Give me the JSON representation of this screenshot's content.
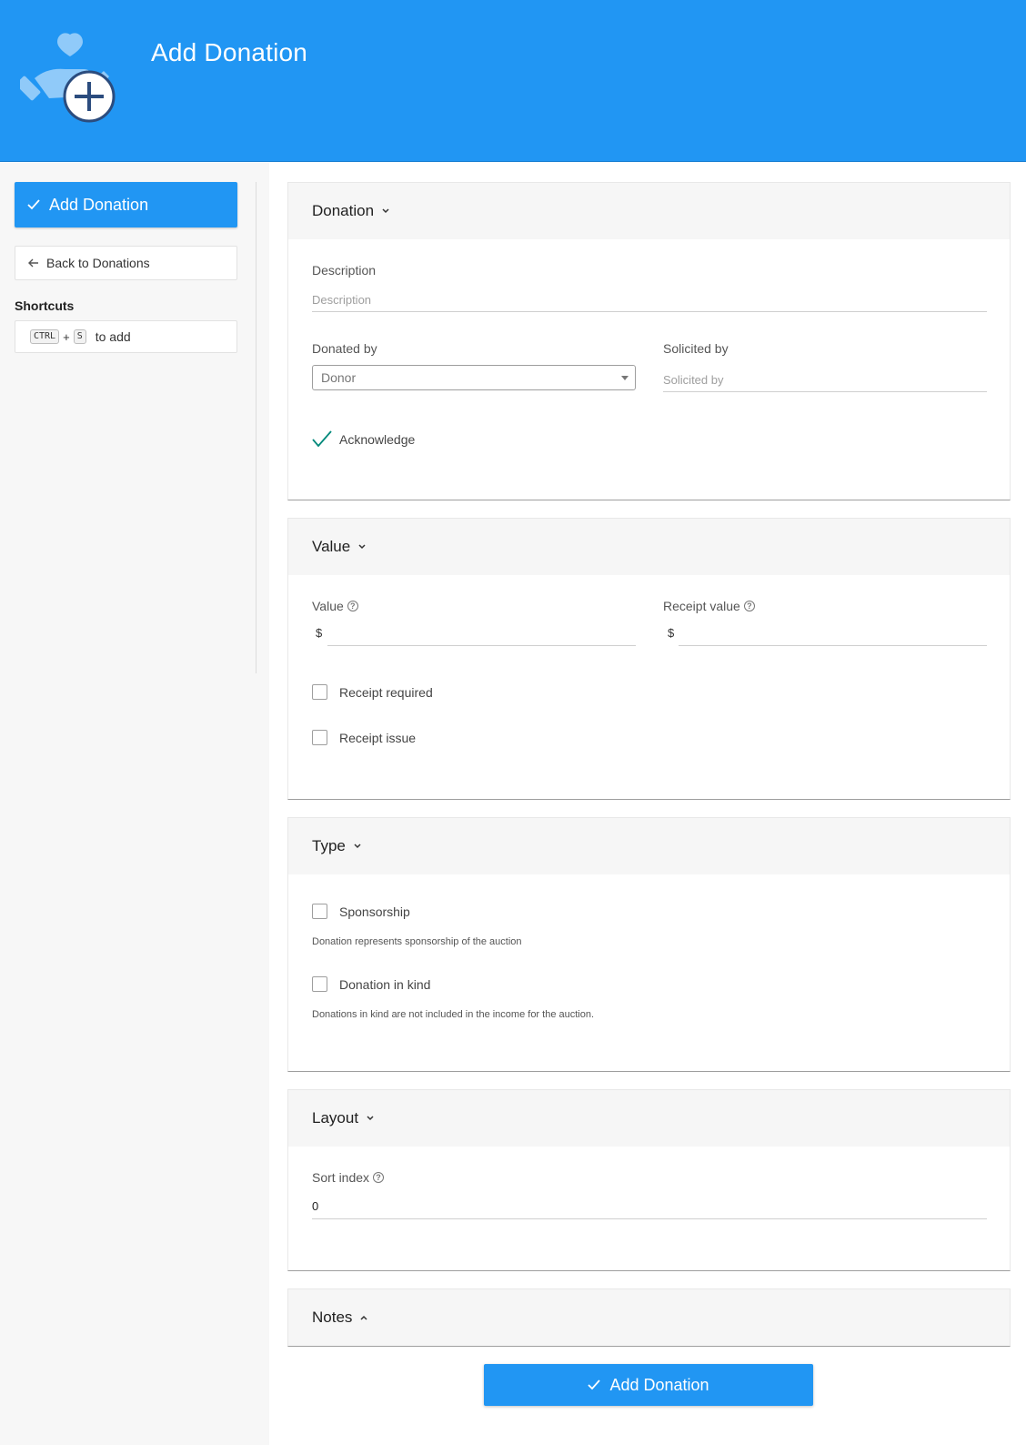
{
  "header": {
    "title": "Add Donation",
    "logo_icon": "hand-heart-plus-icon"
  },
  "sidebar": {
    "add_button_label": "Add Donation",
    "back_button_label": "Back to Donations",
    "shortcuts_title": "Shortcuts",
    "shortcut": {
      "key1": "CTRL",
      "plus": "+",
      "key2": "S",
      "text": "to add"
    }
  },
  "sections": {
    "donation": {
      "title": "Donation",
      "description_label": "Description",
      "description_placeholder": "Description",
      "donated_by_label": "Donated by",
      "donated_by_value": "Donor",
      "solicited_by_label": "Solicited by",
      "solicited_by_placeholder": "Solicited by",
      "acknowledge_label": "Acknowledge"
    },
    "value": {
      "title": "Value",
      "value_label": "Value",
      "value_prefix": "$",
      "receipt_value_label": "Receipt value",
      "receipt_value_prefix": "$",
      "receipt_required_label": "Receipt required",
      "receipt_issue_label": "Receipt issue"
    },
    "type": {
      "title": "Type",
      "sponsorship_label": "Sponsorship",
      "sponsorship_hint": "Donation represents sponsorship of the auction",
      "in_kind_label": "Donation in kind",
      "in_kind_hint": "Donations in kind are not included in the income for the auction."
    },
    "layout": {
      "title": "Layout",
      "sort_index_label": "Sort index",
      "sort_index_value": "0"
    },
    "notes": {
      "title": "Notes"
    }
  },
  "submit_label": "Add Donation",
  "colors": {
    "primary": "#2196f3",
    "check": "#00897b"
  }
}
